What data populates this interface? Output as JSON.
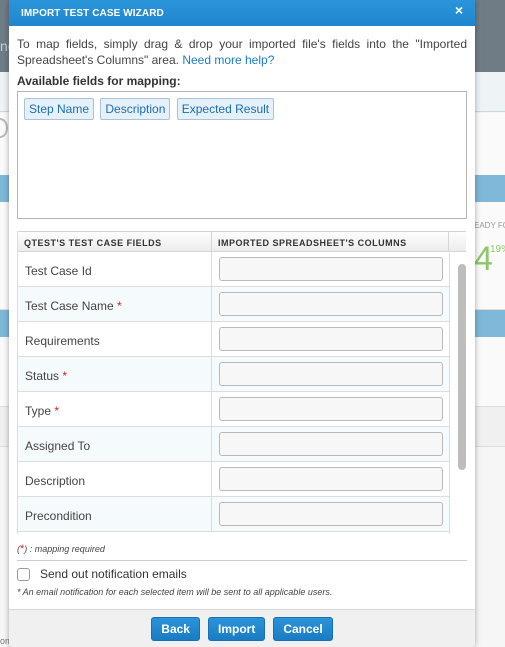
{
  "background": {
    "fragment_text": "ne",
    "ready_label": "EADY FO",
    "big_number": "4",
    "percent": "19%",
    "bottom_fragment": "om"
  },
  "modal": {
    "title": "IMPORT TEST CASE WIZARD",
    "close_icon": "×",
    "intro_text": "To map fields, simply drag & drop your imported file's fields into the \"Imported Spreadsheet's Columns\" area. ",
    "help_link": "Need more help?",
    "available_label": "Available fields for mapping:",
    "available_fields": [
      "Step Name",
      "Description",
      "Expected Result"
    ],
    "table": {
      "headers": [
        "QTEST'S TEST CASE FIELDS",
        "IMPORTED SPREADSHEET'S COLUMNS"
      ],
      "rows": [
        {
          "field": "Test Case Id",
          "required": "",
          "value": ""
        },
        {
          "field": "Test Case Name",
          "required": "*",
          "value": ""
        },
        {
          "field": "Requirements",
          "required": "",
          "value": ""
        },
        {
          "field": "Status",
          "required": "*",
          "value": ""
        },
        {
          "field": "Type",
          "required": "*",
          "value": ""
        },
        {
          "field": "Assigned To",
          "required": "",
          "value": ""
        },
        {
          "field": "Description",
          "required": "",
          "value": ""
        },
        {
          "field": "Precondition",
          "required": "",
          "value": ""
        }
      ]
    },
    "legend": {
      "open": "(",
      "star": "*",
      "close": ") :",
      "text": " mapping required"
    },
    "notify_label": "Send out notification emails",
    "notify_checked": false,
    "note": "* An email notification for each selected item will be sent to all applicable users.",
    "buttons": {
      "back": "Back",
      "import": "Import",
      "cancel": "Cancel"
    }
  },
  "colors": {
    "header_blue": "#1e86cf",
    "button_blue": "#1a7dc4",
    "link_blue": "#1a7cc4",
    "required_red": "#d21e1e"
  }
}
